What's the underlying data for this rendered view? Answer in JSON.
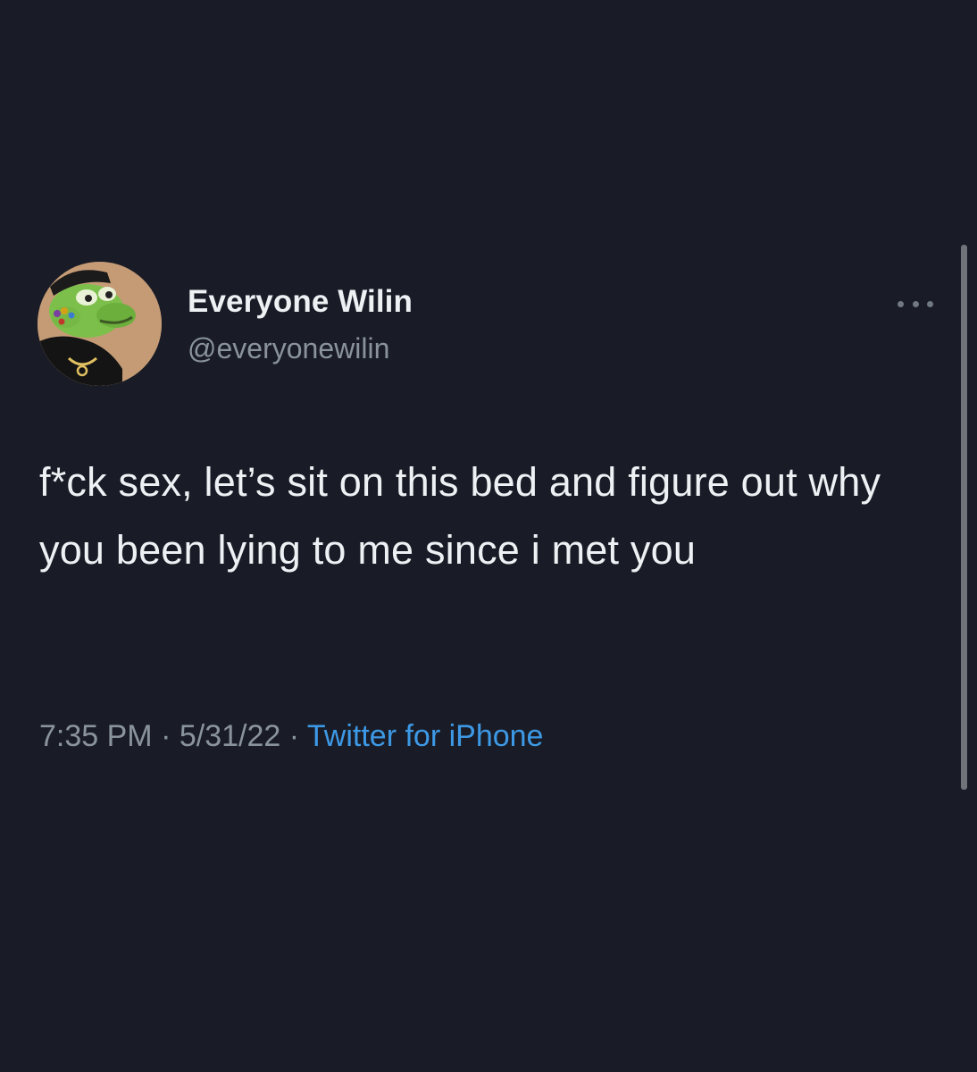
{
  "tweet": {
    "author": {
      "display_name": "Everyone Wilin",
      "handle": "@everyonewilin",
      "avatar_icon": "cartoon-frog-avatar"
    },
    "more_icon": "more-dots-icon",
    "text": "f*ck sex, let’s sit on this bed and figure out why you been lying to me since i met you",
    "time": "7:35 PM",
    "date": "5/31/22",
    "separator": " · ",
    "source": "Twitter for iPhone"
  },
  "colors": {
    "background": "#191c26",
    "text": "#eef1f4",
    "muted": "#8a939d",
    "link": "#3d99e6"
  }
}
